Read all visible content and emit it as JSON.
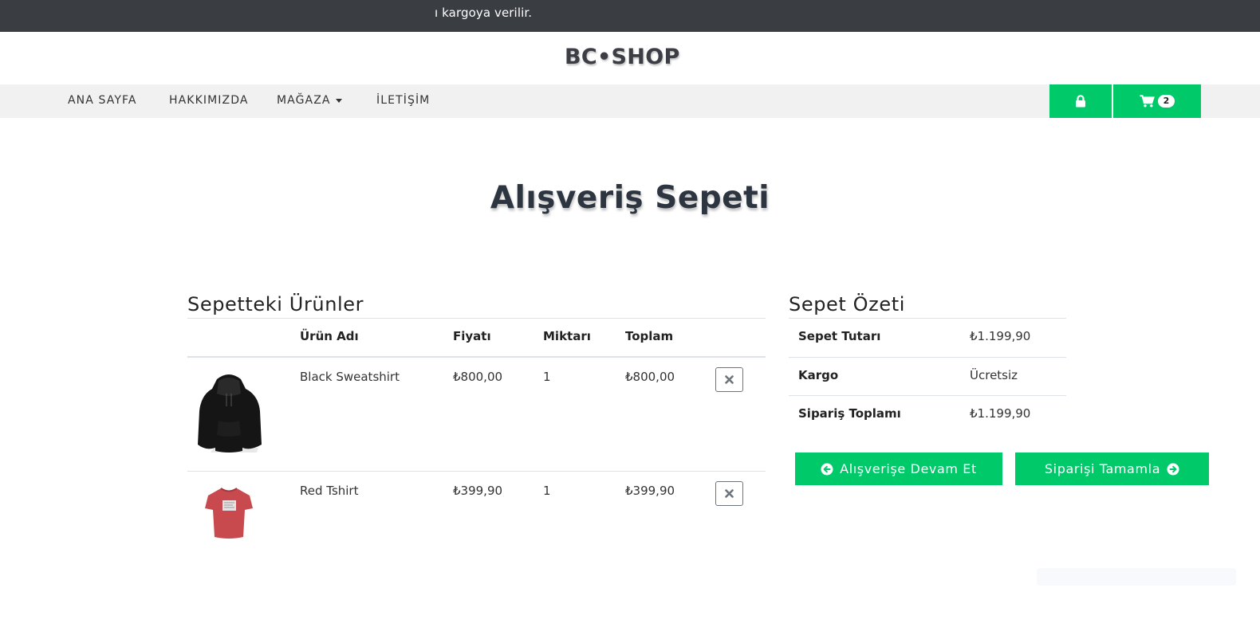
{
  "announcement": {
    "text": "ı kargoya verilir."
  },
  "brand": {
    "logo_text": "BC•SHOP"
  },
  "nav": {
    "items": [
      {
        "label": "ANA SAYFA"
      },
      {
        "label": "HAKKIMIZDA"
      },
      {
        "label": "MAĞAZA"
      },
      {
        "label": "İLETİŞİM"
      }
    ],
    "login_icon": "lock-icon",
    "cart_icon": "cart-icon",
    "cart_count": "2"
  },
  "page": {
    "title": "Alışveriş Sepeti"
  },
  "cart": {
    "heading": "Sepetteki Ürünler",
    "columns": [
      "",
      "Ürün Adı",
      "Fiyatı",
      "Miktarı",
      "Toplam",
      ""
    ],
    "rows": [
      {
        "name": "Black Sweatshirt",
        "price": "₺800,00",
        "qty": "1",
        "total": "₺800,00",
        "image": "black-hoodie"
      },
      {
        "name": "Red Tshirt",
        "price": "₺399,90",
        "qty": "1",
        "total": "₺399,90",
        "image": "red-tshirt"
      }
    ]
  },
  "summary": {
    "heading": "Sepet Özeti",
    "rows": [
      {
        "label": "Sepet Tutarı",
        "value": "₺1.199,90"
      },
      {
        "label": "Kargo",
        "value": "Ücretsiz"
      },
      {
        "label": "Sipariş Toplamı",
        "value": "₺1.199,90"
      }
    ]
  },
  "actions": {
    "continue_label": "Alışverişe Devam Et",
    "checkout_label": "Siparişi Tamamla"
  },
  "colors": {
    "accent": "#00c96a",
    "topbar": "#3a3d42",
    "navbar": "#f0f1f0"
  }
}
